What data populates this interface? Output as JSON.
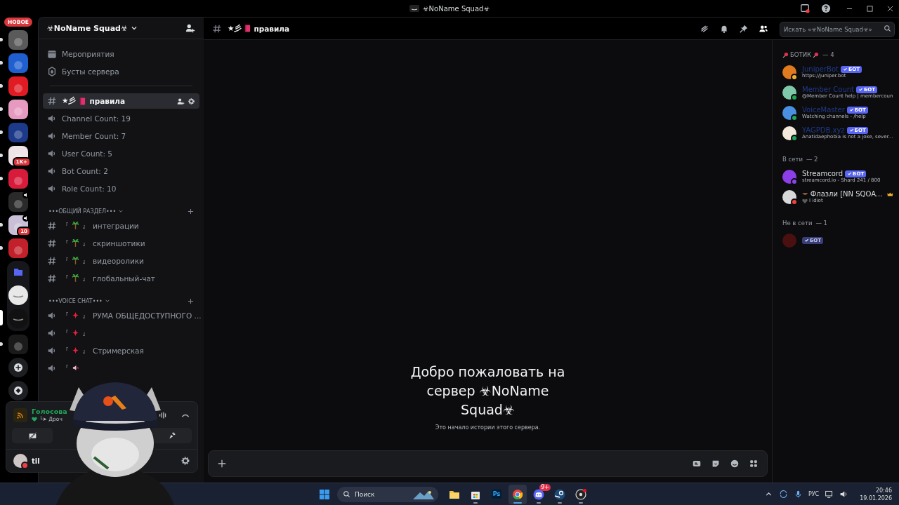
{
  "titlebar": {
    "title": "☣NoName Squad☣"
  },
  "rail": {
    "new_badge": "НОВОЕ",
    "servers": [
      {
        "kind": "server",
        "color": "#5a5a5a",
        "unread": true,
        "selected": false
      },
      {
        "kind": "server",
        "color": "#1f5fd0",
        "unread": true,
        "selected": false
      },
      {
        "kind": "server",
        "color": "#e01b24",
        "unread": true,
        "selected": false
      },
      {
        "kind": "server",
        "color": "#e79ac0",
        "unread": true,
        "selected": false
      },
      {
        "kind": "server",
        "color": "#1d3a8a",
        "unread": true,
        "selected": false
      },
      {
        "kind": "server",
        "color": "#efe4e8",
        "badge": "1K+",
        "unread": true,
        "selected": false
      },
      {
        "kind": "server",
        "color": "#d81b3b",
        "unread": true,
        "selected": false
      },
      {
        "kind": "server",
        "color": "#2a2a2a",
        "voice": true,
        "unread": false,
        "selected": false
      },
      {
        "kind": "server",
        "color": "#c9c0d8",
        "voice": true,
        "badge": "10",
        "unread": true,
        "selected": false
      },
      {
        "kind": "server",
        "color": "#c2202a",
        "unread": true,
        "selected": false
      },
      {
        "kind": "folder",
        "color": "#5865f2",
        "servers": [
          {
            "color": "#e8e8e8",
            "selected": false
          },
          {
            "color": "#111111",
            "selected": true
          }
        ]
      },
      {
        "kind": "server",
        "color": "#1a1a1a",
        "unread": true,
        "selected": false
      },
      {
        "kind": "add"
      },
      {
        "kind": "discover"
      }
    ]
  },
  "sidebar": {
    "server_name": "☣NoName Squad☣",
    "links": [
      {
        "kind": "events",
        "label": "Мероприятия"
      },
      {
        "kind": "boosts",
        "label": "Бусты сервера"
      }
    ],
    "channels": [
      {
        "kind": "text",
        "deco": "★彡",
        "emoji": {
          "kind": "book"
        },
        "name": "правила",
        "selected": true
      },
      {
        "kind": "stat",
        "name": "Channel Count: 19",
        "selected": false
      },
      {
        "kind": "stat",
        "name": "Member Count: 7",
        "selected": false
      },
      {
        "kind": "stat",
        "name": "User Count: 5",
        "selected": false
      },
      {
        "kind": "stat",
        "name": "Bot Count: 2",
        "selected": false
      },
      {
        "kind": "stat",
        "name": "Role Count: 10",
        "selected": false
      }
    ],
    "categories": [
      {
        "name": "•••ОБЩИЙ РАЗДЕЛ•••",
        "channels": [
          {
            "kind": "text",
            "left": "『",
            "emoji": {
              "kind": "palm"
            },
            "right": "』",
            "name": "интеграции",
            "selected": false
          },
          {
            "kind": "text",
            "left": "『",
            "emoji": {
              "kind": "palm"
            },
            "right": "』",
            "name": "скриншотики",
            "selected": false
          },
          {
            "kind": "text",
            "left": "『",
            "emoji": {
              "kind": "palm"
            },
            "right": "』",
            "name": "видеоролики",
            "selected": false
          },
          {
            "kind": "text",
            "left": "『",
            "emoji": {
              "kind": "palm"
            },
            "right": "』",
            "name": "глобальный-чат",
            "selected": false
          }
        ]
      },
      {
        "name": "•••VOICE CHAT•••",
        "channels": [
          {
            "kind": "voice",
            "left": "『",
            "emoji": {
              "kind": "spark"
            },
            "right": "』",
            "name": "РУМА ОБЩЕДОСТУПНОГО ...",
            "selected": false
          },
          {
            "kind": "voice",
            "left": "『",
            "emoji": {
              "kind": "spark"
            },
            "right": "』",
            "selected": false
          },
          {
            "kind": "voice",
            "left": "『",
            "emoji": {
              "kind": "spark"
            },
            "right": "』",
            "name": "Стримерская",
            "selected": false
          },
          {
            "kind": "voice",
            "left": "『",
            "emoji": {
              "kind": "mute"
            },
            "selected": false
          }
        ]
      }
    ],
    "voice": {
      "status": "Голосова",
      "detail": "└➤ Дроч"
    },
    "user": {
      "name": "til",
      "status": {
        "color": "#f23f43"
      }
    }
  },
  "channel": {
    "deco": "★彡",
    "emoji": {
      "kind": "book"
    },
    "name": "правила",
    "search": {
      "placeholder": "Искать «☣NoName Squad☣»"
    }
  },
  "welcome": {
    "title": "Добро пожаловать на сервер ☣NoName Squad☣",
    "subtitle": "Это начало истории этого сервера."
  },
  "members": {
    "sections": [
      {
        "label": "БОТИК",
        "pins": true,
        "count": "— 4",
        "members": [
          {
            "name": "JuniperBot",
            "color": "#1e3a8a",
            "tag": "БОТ",
            "status": {
              "color": "#f0b232"
            },
            "status_text": "https://juniper.bot",
            "avatar": {
              "color": "#e07a1f"
            }
          },
          {
            "name": "Member Count",
            "color": "#1e3a8a",
            "tag": "БОТ",
            "status": {
              "color": "#23a55a"
            },
            "status_text": "@Member Count help | membercoun",
            "avatar": {
              "color": "#7fc8a9"
            }
          },
          {
            "name": "VoiceMaster",
            "color": "#1e3a8a",
            "tag": "БОТ",
            "status": {
              "color": "#23a55a"
            },
            "status_text": "Watching channels - /help",
            "avatar": {
              "color": "#4a90e2"
            }
          },
          {
            "name": "YAGPDB.xyz",
            "color": "#1e3a8a",
            "tag": "БОТ",
            "status": {
              "color": "#23a55a"
            },
            "status_text": "Anatidaephobia is not a joke, sever...",
            "avatar": {
              "color": "#f2e8dc"
            }
          }
        ]
      },
      {
        "label": "В сети",
        "pins": false,
        "count": "— 2",
        "members": [
          {
            "name": "Streamcord",
            "color": "#dbdee1",
            "tag": "БОТ",
            "status": {
              "color": "#8c44e8"
            },
            "status_text": "streamcord.io - Shard 241 / 800",
            "avatar": {
              "color": "#8c3ee8"
            }
          },
          {
            "name": "Флазли [NN SQOA...",
            "emoji": {
              "kind": "watermelon"
            },
            "owner": true,
            "color": "#dbdee1",
            "status": {
              "color": "#f23f43"
            },
            "status_emoji": {
              "kind": "heart"
            },
            "status_text": "I idiot",
            "avatar": {
              "color": "#d8d8d8"
            }
          }
        ]
      },
      {
        "label": "Не в сети",
        "pins": false,
        "count": "— 1",
        "members": [
          {
            "tag": "БОТ",
            "avatar": {
              "color": "#4a1010"
            }
          }
        ]
      }
    ]
  },
  "taskbar": {
    "search": "Поиск",
    "apps": [
      {
        "kind": "explorer",
        "running": false,
        "active": false
      },
      {
        "kind": "store",
        "running": true,
        "active": false
      },
      {
        "kind": "photoshop",
        "label": "Ps",
        "running": false,
        "active": false
      },
      {
        "kind": "chrome",
        "running": true,
        "active": true
      },
      {
        "kind": "discord",
        "badge": "9+",
        "running": true,
        "active": false
      },
      {
        "kind": "steam",
        "running": true,
        "active": false
      },
      {
        "kind": "obs",
        "running": true,
        "active": false
      }
    ],
    "lang": "РУС",
    "time": "20:46",
    "date": "19.01.2026"
  }
}
